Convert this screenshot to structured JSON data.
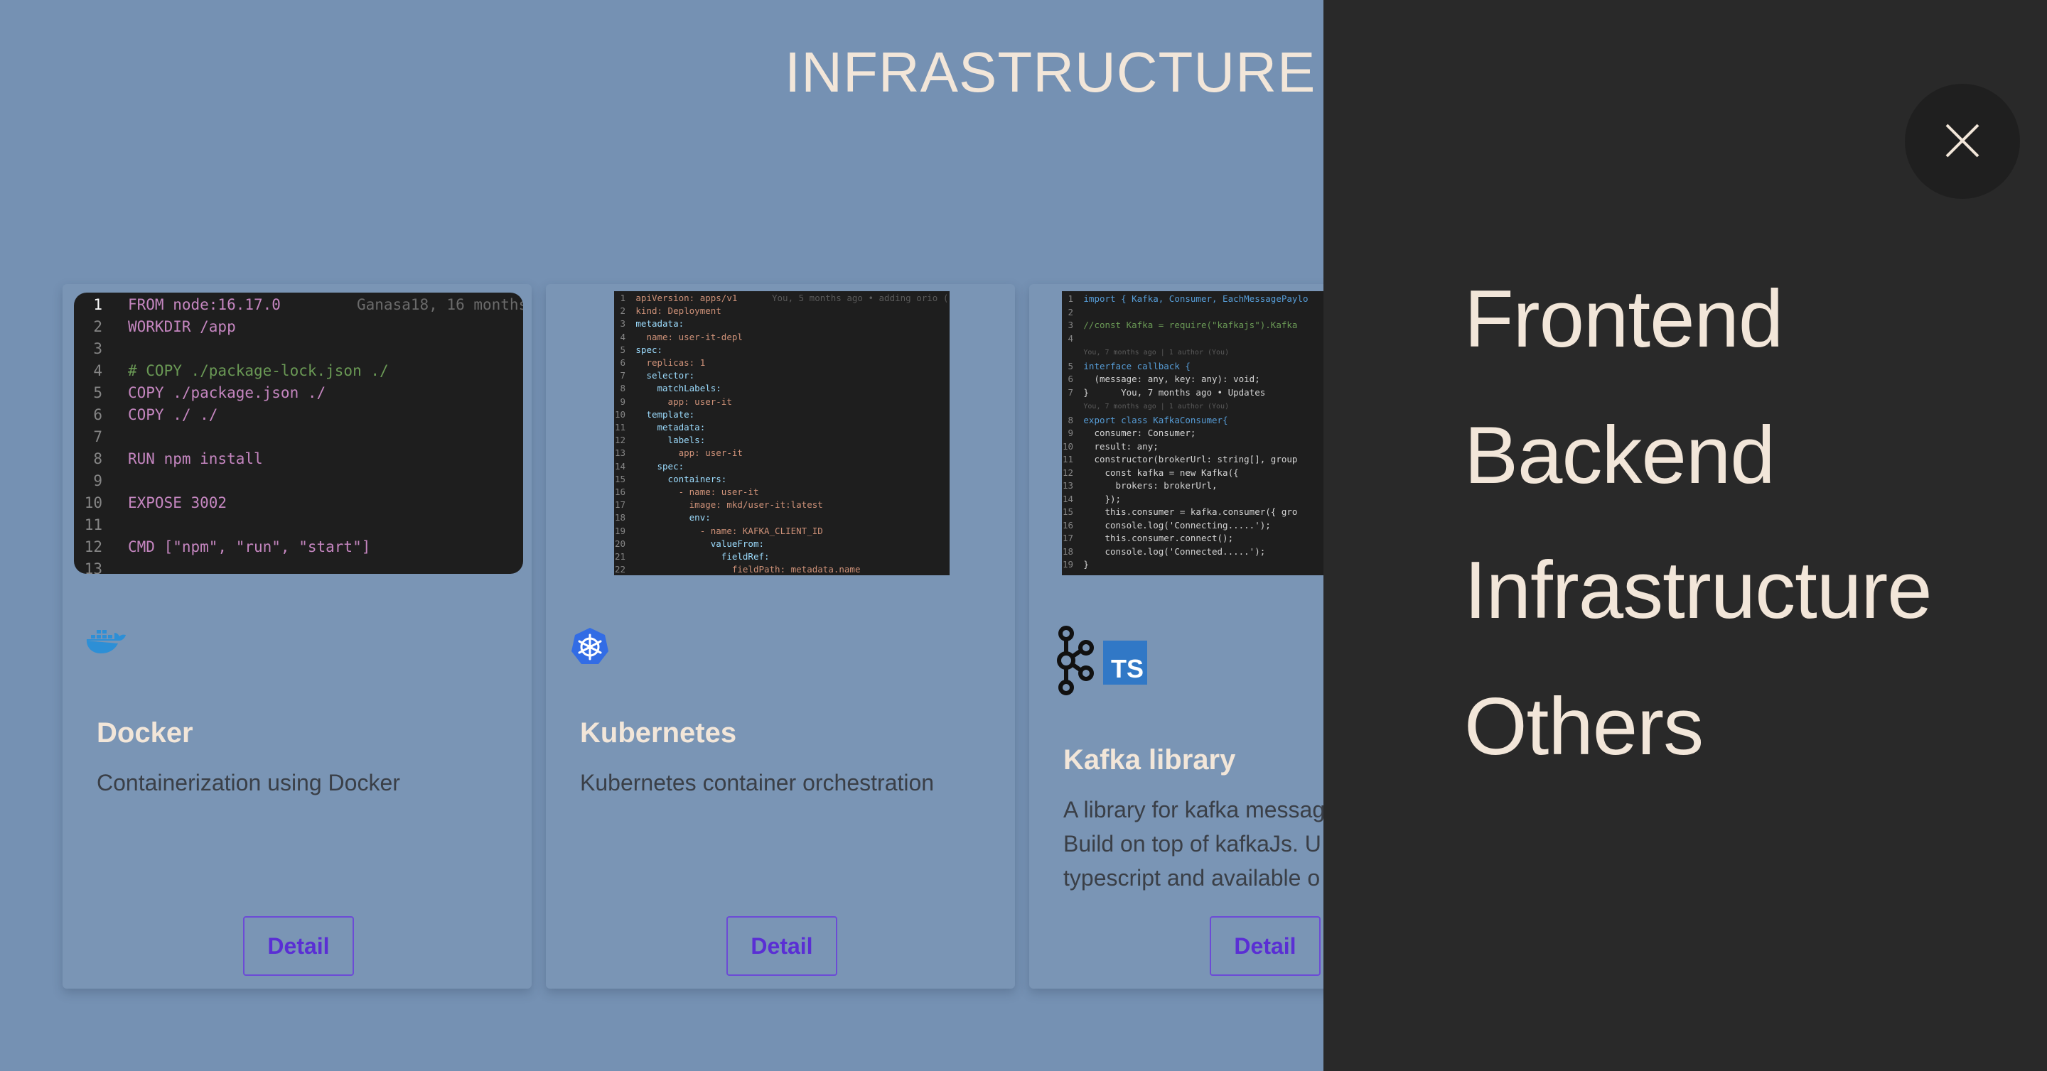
{
  "page": {
    "title": "INFRASTRUCTURE"
  },
  "cards": [
    {
      "title": "Docker",
      "description": "Containerization using Docker",
      "detail_label": "Detail",
      "logos": [
        "docker-icon"
      ],
      "code": {
        "blame": "Ganasa18, 16 months",
        "lines": [
          {
            "n": "1",
            "t": "FROM node:16.17.0"
          },
          {
            "n": "2",
            "t": "WORKDIR /app"
          },
          {
            "n": "3",
            "t": ""
          },
          {
            "n": "4",
            "t": "# COPY ./package-lock.json ./"
          },
          {
            "n": "5",
            "t": "COPY ./package.json ./"
          },
          {
            "n": "6",
            "t": "COPY ./ ./"
          },
          {
            "n": "7",
            "t": ""
          },
          {
            "n": "8",
            "t": "RUN npm install"
          },
          {
            "n": "9",
            "t": ""
          },
          {
            "n": "10",
            "t": "EXPOSE 3002"
          },
          {
            "n": "11",
            "t": ""
          },
          {
            "n": "12",
            "t": "CMD [\"npm\", \"run\", \"start\"]"
          },
          {
            "n": "13",
            "t": ""
          }
        ]
      }
    },
    {
      "title": "Kubernetes",
      "description": "Kubernetes container orchestration",
      "detail_label": "Detail",
      "logos": [
        "kubernetes-icon"
      ],
      "code": {
        "blame": "You, 5 months ago • adding orio (",
        "lines": [
          {
            "n": "1",
            "t": "apiVersion: apps/v1"
          },
          {
            "n": "2",
            "t": "kind: Deployment"
          },
          {
            "n": "3",
            "t": "metadata:"
          },
          {
            "n": "4",
            "t": "  name: user-it-depl"
          },
          {
            "n": "5",
            "t": "spec:"
          },
          {
            "n": "6",
            "t": "  replicas: 1"
          },
          {
            "n": "7",
            "t": "  selector:"
          },
          {
            "n": "8",
            "t": "    matchLabels:"
          },
          {
            "n": "9",
            "t": "      app: user-it"
          },
          {
            "n": "10",
            "t": "  template:"
          },
          {
            "n": "11",
            "t": "    metadata:"
          },
          {
            "n": "12",
            "t": "      labels:"
          },
          {
            "n": "13",
            "t": "        app: user-it"
          },
          {
            "n": "14",
            "t": "    spec:"
          },
          {
            "n": "15",
            "t": "      containers:"
          },
          {
            "n": "16",
            "t": "        - name: user-it"
          },
          {
            "n": "17",
            "t": "          image: mkd/user-it:latest"
          },
          {
            "n": "18",
            "t": "          env:"
          },
          {
            "n": "19",
            "t": "            - name: KAFKA_CLIENT_ID"
          },
          {
            "n": "20",
            "t": "              valueFrom:"
          },
          {
            "n": "21",
            "t": "                fieldRef:"
          },
          {
            "n": "22",
            "t": "                  fieldPath: metadata.name"
          }
        ]
      }
    },
    {
      "title": "Kafka library",
      "description_lines": [
        "A library for kafka messag",
        "Build on top of kafkaJs. U",
        "typescript and available o"
      ],
      "detail_label": "Detail",
      "logos": [
        "kafka-icon",
        "typescript-icon"
      ],
      "ts_badge": "TS",
      "code": {
        "lines": [
          {
            "n": "1",
            "t": "import { Kafka, Consumer, EachMessagePaylo"
          },
          {
            "n": "2",
            "t": ""
          },
          {
            "n": "3",
            "t": "//const Kafka = require(\"kafkajs\").Kafka"
          },
          {
            "n": "4",
            "t": ""
          },
          {
            "n": "",
            "t": "You, 7 months ago | 1 author (You)"
          },
          {
            "n": "5",
            "t": "interface callback {"
          },
          {
            "n": "6",
            "t": "  (message: any, key: any): void;"
          },
          {
            "n": "7",
            "t": "}      You, 7 months ago • Updates"
          },
          {
            "n": "",
            "t": "You, 7 months ago | 1 author (You)"
          },
          {
            "n": "8",
            "t": "export class KafkaConsumer{"
          },
          {
            "n": "9",
            "t": "  consumer: Consumer;"
          },
          {
            "n": "10",
            "t": "  result: any;"
          },
          {
            "n": "11",
            "t": "  constructor(brokerUrl: string[], group"
          },
          {
            "n": "12",
            "t": "    const kafka = new Kafka({"
          },
          {
            "n": "13",
            "t": "      brokers: brokerUrl,"
          },
          {
            "n": "14",
            "t": "    });"
          },
          {
            "n": "15",
            "t": "    this.consumer = kafka.consumer({ gro"
          },
          {
            "n": "16",
            "t": "    console.log('Connecting.....');"
          },
          {
            "n": "17",
            "t": "    this.consumer.connect();"
          },
          {
            "n": "18",
            "t": "    console.log('Connected.....');"
          },
          {
            "n": "19",
            "t": "}"
          }
        ]
      }
    }
  ],
  "drawer": {
    "close_icon": "close-icon",
    "items": [
      "Frontend",
      "Backend",
      "Infrastructure",
      "Others"
    ]
  }
}
